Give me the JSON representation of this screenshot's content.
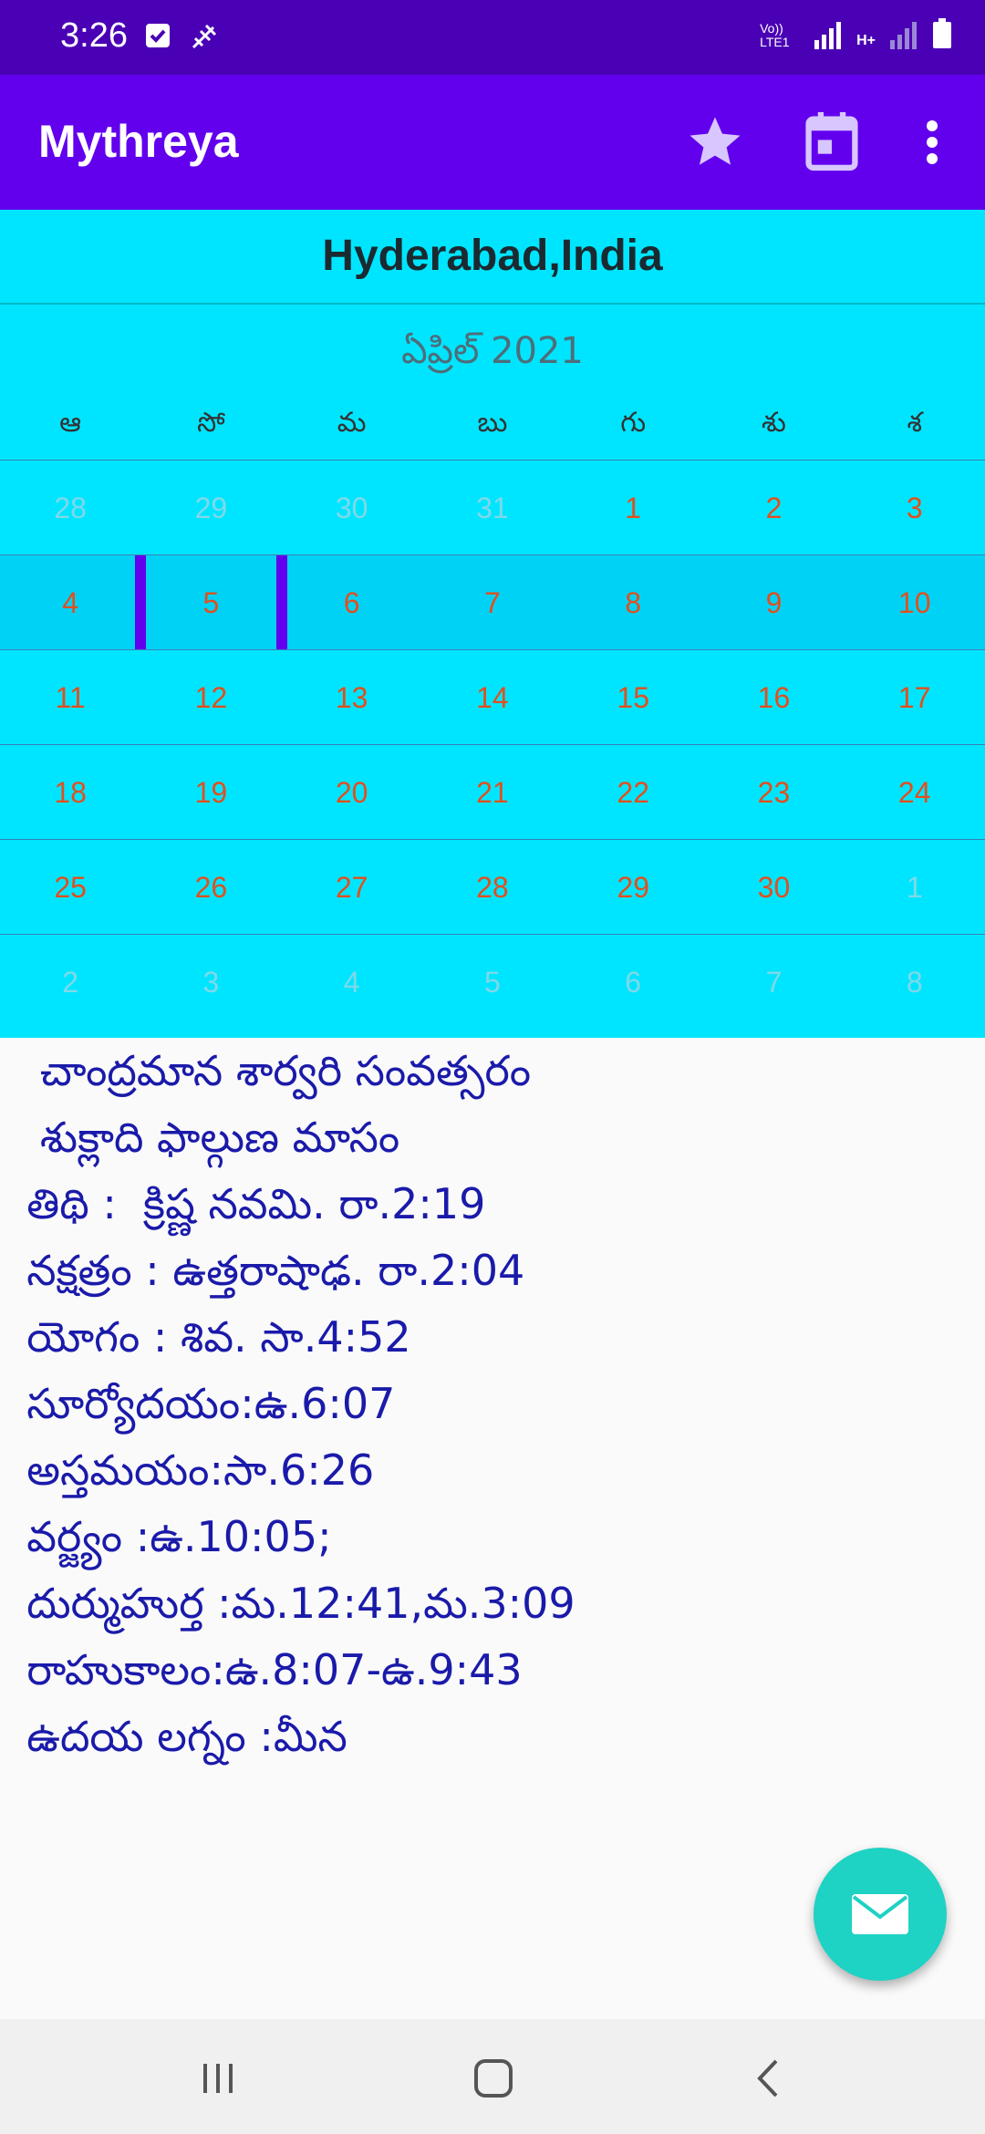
{
  "status": {
    "time": "3:26",
    "network": "Vo)) LTE1",
    "data_type": "H+"
  },
  "app": {
    "title": "Mythreya"
  },
  "location": "Hyderabad,India",
  "calendar": {
    "month": "ఏప్రిల్ 2021",
    "weekdays": [
      "ఆ",
      "సో",
      "మ",
      "బు",
      "గు",
      "శు",
      "శ"
    ],
    "weeks": [
      [
        {
          "d": "28",
          "o": true
        },
        {
          "d": "29",
          "o": true
        },
        {
          "d": "30",
          "o": true
        },
        {
          "d": "31",
          "o": true
        },
        {
          "d": "1",
          "o": false
        },
        {
          "d": "2",
          "o": false
        },
        {
          "d": "3",
          "o": false
        }
      ],
      [
        {
          "d": "4",
          "o": false
        },
        {
          "d": "5",
          "o": false,
          "sel": true
        },
        {
          "d": "6",
          "o": false
        },
        {
          "d": "7",
          "o": false
        },
        {
          "d": "8",
          "o": false
        },
        {
          "d": "9",
          "o": false
        },
        {
          "d": "10",
          "o": false
        }
      ],
      [
        {
          "d": "11",
          "o": false
        },
        {
          "d": "12",
          "o": false
        },
        {
          "d": "13",
          "o": false
        },
        {
          "d": "14",
          "o": false
        },
        {
          "d": "15",
          "o": false
        },
        {
          "d": "16",
          "o": false
        },
        {
          "d": "17",
          "o": false
        }
      ],
      [
        {
          "d": "18",
          "o": false
        },
        {
          "d": "19",
          "o": false
        },
        {
          "d": "20",
          "o": false
        },
        {
          "d": "21",
          "o": false
        },
        {
          "d": "22",
          "o": false
        },
        {
          "d": "23",
          "o": false
        },
        {
          "d": "24",
          "o": false
        }
      ],
      [
        {
          "d": "25",
          "o": false
        },
        {
          "d": "26",
          "o": false
        },
        {
          "d": "27",
          "o": false
        },
        {
          "d": "28",
          "o": false
        },
        {
          "d": "29",
          "o": false
        },
        {
          "d": "30",
          "o": false
        },
        {
          "d": "1",
          "o": true
        }
      ],
      [
        {
          "d": "2",
          "o": true
        },
        {
          "d": "3",
          "o": true
        },
        {
          "d": "4",
          "o": true
        },
        {
          "d": "5",
          "o": true
        },
        {
          "d": "6",
          "o": true
        },
        {
          "d": "7",
          "o": true
        },
        {
          "d": "8",
          "o": true
        }
      ]
    ]
  },
  "panchang": [
    "   చాంద్రమాన శార్వరి సంవత్సరం",
    "   శుక్లాది ఫాల్గుణ మాసం",
    "  తిథి :  క్రిష్ణ నవమి. రా.2:19",
    "  నక్షత్రం : ఉత్తరాషాఢ. రా.2:04",
    "  యోగం : శివ. సా.4:52",
    "  సూర్యోదయం:ఉ.6:07",
    "  అస్తమయం:సా.6:26",
    "  వర్జ్యం :ఉ.10:05;",
    "  దుర్ముహుర్త :మ.12:41,మ.3:09",
    "  రాహుకాలం:ఉ.8:07-ఉ.9:43",
    "  ఉదయ లగ్నం :మీన"
  ],
  "colors": {
    "primary": "#6200ee",
    "primary_dark": "#4a00b4",
    "calendar_bg": "#00e5ff",
    "date_text": "#e0501e",
    "panchang_text": "#1a1aaa",
    "fab": "#1ed2c4"
  },
  "icons": {
    "star": "star-icon",
    "calendar": "calendar-icon",
    "more": "more-vert-icon",
    "fab": "mail-icon"
  }
}
